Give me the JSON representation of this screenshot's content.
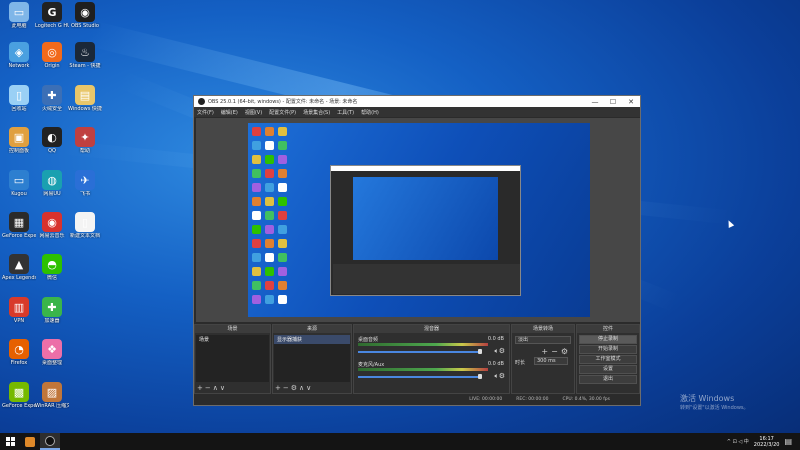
{
  "desktop": {
    "icons": [
      {
        "label": "此电脑",
        "color": "#7fb6e8",
        "glyph": "▭"
      },
      {
        "label": "Logitech G HUB",
        "color": "#222222",
        "glyph": "G"
      },
      {
        "label": "OBS Studio",
        "color": "#1f1f1f",
        "glyph": "◉"
      },
      {
        "label": "Network",
        "color": "#4aa0e0",
        "glyph": "◈"
      },
      {
        "label": "Origin",
        "color": "#f26a1b",
        "glyph": "◎"
      },
      {
        "label": "Steam - 快捷",
        "color": "#1b2838",
        "glyph": "♨"
      },
      {
        "label": "回收站",
        "color": "#9ad0f5",
        "glyph": "▯"
      },
      {
        "label": "火绒安全",
        "color": "#3b6fb6",
        "glyph": "✚"
      },
      {
        "label": "Windows 快捷方式",
        "color": "#e8c66a",
        "glyph": "▤"
      },
      {
        "label": "控制面板",
        "color": "#e0a040",
        "glyph": "▣"
      },
      {
        "label": "QQ",
        "color": "#222222",
        "glyph": "◐"
      },
      {
        "label": "帮助",
        "color": "#c04040",
        "glyph": "✦"
      },
      {
        "label": "Kugou",
        "color": "#2d7fd0",
        "glyph": "▭"
      },
      {
        "label": "网易UU",
        "color": "#1aa0b0",
        "glyph": "◍"
      },
      {
        "label": "飞书",
        "color": "#2a6fd6",
        "glyph": "✈"
      },
      {
        "label": "GeForce Experience",
        "color": "#2b2b2b",
        "glyph": "▦"
      },
      {
        "label": "网易云音乐",
        "color": "#d8322e",
        "glyph": "◉"
      },
      {
        "label": "新建文本文档",
        "color": "#f4f4f4",
        "glyph": "▯"
      },
      {
        "label": "Apex Legends",
        "color": "#333333",
        "glyph": "▲"
      },
      {
        "label": "微信",
        "color": "#2dc100",
        "glyph": "◓"
      },
      {
        "label": "VPN",
        "color": "#d83a2a",
        "glyph": "▥"
      },
      {
        "label": "加速器",
        "color": "#3ab54a",
        "glyph": "✚"
      },
      {
        "label": "Firefox",
        "color": "#e66000",
        "glyph": "◔"
      },
      {
        "label": "桌面整理",
        "color": "#ec6fa8",
        "glyph": "❖"
      },
      {
        "label": "GeForce Experience",
        "color": "#76b900",
        "glyph": "▩"
      },
      {
        "label": "WinRAR 压缩文件管理器",
        "color": "#c0763a",
        "glyph": "▨"
      }
    ]
  },
  "obs": {
    "title": "OBS 25.0.1 (64-bit, windows) - 配置文件: 未命名 - 场景: 未命名",
    "menu": [
      "文件(F)",
      "编辑(E)",
      "视图(V)",
      "配置文件(P)",
      "场景集合(S)",
      "工具(T)",
      "帮助(H)"
    ],
    "docks": {
      "scenes": {
        "title": "场景",
        "items": [
          "场景"
        ]
      },
      "sources": {
        "title": "来源",
        "items": [
          "显示器捕获"
        ]
      },
      "mixer": {
        "title": "混音器",
        "channels": [
          {
            "name": "桌面音频",
            "db": "0.0 dB"
          },
          {
            "name": "麦克风/Aux",
            "db": "0.0 dB"
          }
        ]
      },
      "transitions": {
        "title": "场景转场",
        "type": "淡出",
        "duration_label": "时长",
        "duration": "300 ms"
      },
      "controls": {
        "title": "控件",
        "buttons": [
          "停止录制",
          "开始录制",
          "工作室模式",
          "设置",
          "退出"
        ]
      }
    },
    "status": {
      "live": "LIVE: 00:00:00",
      "rec": "REC: 00:00:00",
      "cpu": "CPU: 0.4%, 30.00 fps"
    }
  },
  "taskbar": {
    "time": "16:17",
    "date": "2022/3/20",
    "tray_text": "^ ⊡ ◁ 中"
  },
  "watermark": {
    "line1": "激活 Windows",
    "line2": "转到\"设置\"以激活 Windows。"
  }
}
